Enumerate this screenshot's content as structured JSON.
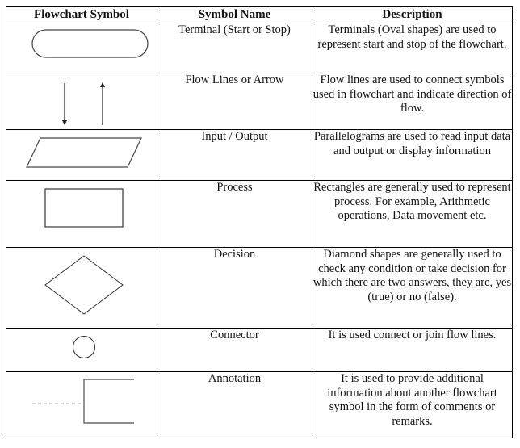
{
  "table": {
    "headers": {
      "symbol": "Flowchart Symbol",
      "name": "Symbol Name",
      "description": "Description"
    },
    "rows": [
      {
        "icon": "terminal-oval-icon",
        "name": "Terminal (Start or Stop)",
        "description": "Terminals (Oval shapes) are used to represent start and stop of the flowchart."
      },
      {
        "icon": "flow-arrows-icon",
        "name": "Flow Lines or Arrow",
        "description": "Flow lines are used to connect symbols used in flowchart and indicate direction of flow."
      },
      {
        "icon": "parallelogram-icon",
        "name": "Input / Output",
        "description": "Parallelograms are used to read input data and output or display information"
      },
      {
        "icon": "rectangle-icon",
        "name": "Process",
        "description": "Rectangles are generally used to represent process. For example, Arithmetic operations, Data movement etc."
      },
      {
        "icon": "diamond-icon",
        "name": "Decision",
        "description": "Diamond shapes are generally used to check any condition or take decision for which there are two answers, they are, yes (true) or no (false)."
      },
      {
        "icon": "circle-connector-icon",
        "name": "Connector",
        "description": "It is used connect or join flow lines."
      },
      {
        "icon": "annotation-bracket-icon",
        "name": "Annotation",
        "description": "It is used to provide additional information about another flowchart symbol in the form of comments or remarks."
      }
    ]
  }
}
